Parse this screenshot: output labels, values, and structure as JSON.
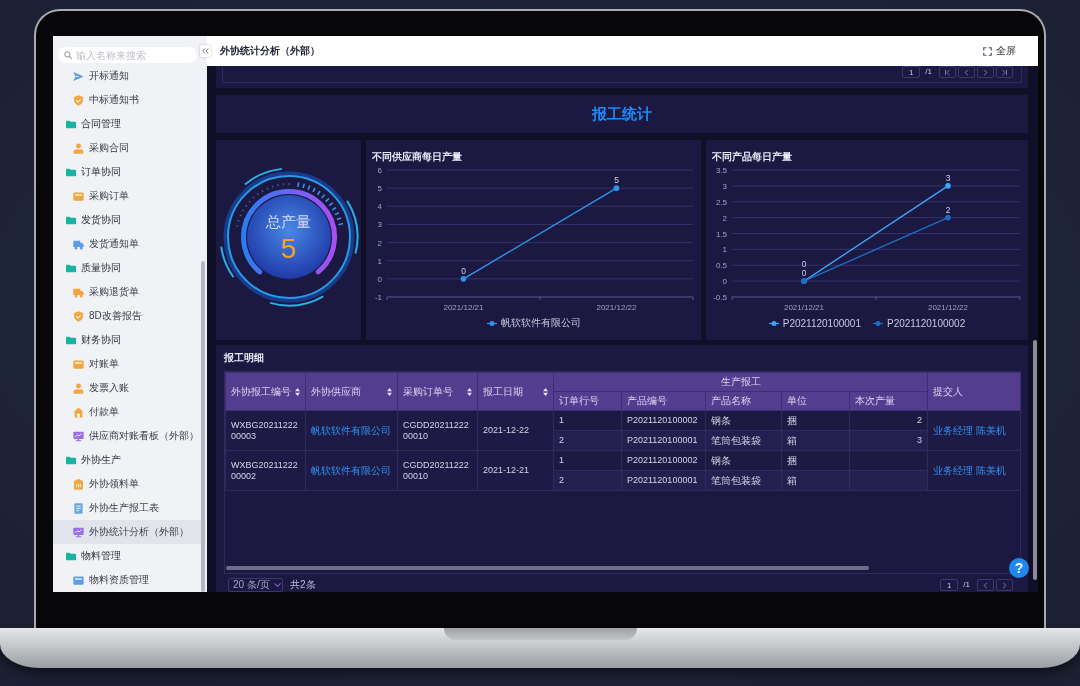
{
  "sidebar": {
    "search": {
      "placeholder": "输入名称来搜索"
    },
    "items": [
      {
        "children": [
          {
            "label": "开标通知",
            "kind": "send",
            "color": "#5b9de6",
            "selected": false
          },
          {
            "label": "中标通知书",
            "kind": "shield",
            "color": "#f2a640",
            "selected": false
          }
        ]
      },
      {
        "label": "合同管理",
        "children": [
          {
            "label": "采购合同",
            "kind": "person",
            "color": "#f2a640",
            "selected": false
          }
        ]
      },
      {
        "label": "订单协同",
        "children": [
          {
            "label": "采购订单",
            "kind": "card",
            "color": "#f2a640",
            "selected": false
          }
        ]
      },
      {
        "label": "发货协同",
        "children": [
          {
            "label": "发货通知单",
            "kind": "truck",
            "color": "#5b9de6",
            "selected": false
          }
        ]
      },
      {
        "label": "质量协同",
        "children": [
          {
            "label": "采购退货单",
            "kind": "truck",
            "color": "#f2a640",
            "selected": false
          },
          {
            "label": "8D改善报告",
            "kind": "shield",
            "color": "#f2a640",
            "selected": false
          }
        ]
      },
      {
        "label": "财务协同",
        "children": [
          {
            "label": "对账单",
            "kind": "card",
            "color": "#f2a640",
            "selected": false
          },
          {
            "label": "发票入账",
            "kind": "person",
            "color": "#f2a640",
            "selected": false
          },
          {
            "label": "付款单",
            "kind": "house",
            "color": "#f2a640",
            "selected": false
          },
          {
            "label": "供应商对账看板（外部）",
            "kind": "monitor",
            "color": "#9b6ee6",
            "selected": false
          }
        ]
      },
      {
        "label": "外协生产",
        "children": [
          {
            "label": "外协领料单",
            "kind": "clipboard",
            "color": "#f2a640",
            "selected": false
          },
          {
            "label": "外协生产报工表",
            "kind": "doc",
            "color": "#6aa6e0",
            "selected": false
          },
          {
            "label": "外协统计分析（外部）",
            "kind": "monitor",
            "color": "#9b6ee6",
            "selected": true
          }
        ]
      },
      {
        "label": "物料管理",
        "children": [
          {
            "label": "物料资质管理",
            "kind": "card",
            "color": "#5b9de6",
            "selected": false
          }
        ]
      }
    ]
  },
  "header": {
    "title": "外协统计分析（外部）",
    "fullscreen": "全屏"
  },
  "top_pager": {
    "page": "1",
    "total": "/1"
  },
  "report": {
    "title": "报工统计",
    "gauge": {
      "label": "总产量",
      "value": "5"
    },
    "charts": [
      {
        "chart_data": {
          "type": "line",
          "title": "不同供应商每日产量",
          "categories": [
            "2021/12/21",
            "2021/12/22"
          ],
          "series": [
            {
              "name": "帆软软件有限公司",
              "color": "#2f95e8",
              "values": [
                0,
                5
              ]
            }
          ],
          "ylim": [
            -1,
            6
          ],
          "yticks": [
            -1,
            0,
            1,
            2,
            3,
            4,
            5,
            6
          ],
          "grid": true,
          "data_labels": true,
          "legend": "bottom"
        }
      },
      {
        "chart_data": {
          "type": "line",
          "title": "不同产品每日产量",
          "categories": [
            "2021/12/21",
            "2021/12/22"
          ],
          "series": [
            {
              "name": "P2021120100001",
              "color": "#3ea4f4",
              "values": [
                0,
                3
              ]
            },
            {
              "name": "P2021120100002",
              "color": "#1f6cc4",
              "values": [
                0,
                2
              ]
            }
          ],
          "ylim": [
            -0.5,
            3.5
          ],
          "yticks": [
            -0.5,
            0,
            0.5,
            1,
            1.5,
            2,
            2.5,
            3,
            3.5
          ],
          "grid": true,
          "data_labels": true,
          "legend": "bottom"
        }
      }
    ]
  },
  "detail": {
    "title": "报工明细",
    "columns": [
      {
        "label": "外协报工编号",
        "sortable": true
      },
      {
        "label": "外协供应商",
        "sortable": true
      },
      {
        "label": "采购订单号",
        "sortable": true
      },
      {
        "label": "报工日期",
        "sortable": true
      },
      {
        "label": "生产报工",
        "children": [
          {
            "label": "订单行号",
            "sortable": false
          },
          {
            "label": "产品编号",
            "sortable": false
          },
          {
            "label": "产品名称",
            "sortable": false
          },
          {
            "label": "单位",
            "sortable": false
          },
          {
            "label": "本次产量",
            "sortable": false
          }
        ]
      },
      {
        "label": "提交人",
        "sortable": false
      }
    ],
    "rows": [
      {
        "report_no": "WXBG2021122200003",
        "supplier": "帆软软件有限公司",
        "order_no": "CGDD2021122200010",
        "date": "2021-12-22",
        "lines": [
          {
            "line_no": "1",
            "product_no": "P2021120100002",
            "product_name": "钢条",
            "unit": "捆",
            "quantity": "2"
          },
          {
            "line_no": "2",
            "product_no": "P2021120100001",
            "product_name": "笔筒包装袋",
            "unit": "箱",
            "quantity": "3"
          }
        ],
        "submitter": "业务经理 陈美机"
      },
      {
        "report_no": "WXBG2021122200002",
        "supplier": "帆软软件有限公司",
        "order_no": "CGDD2021122200010",
        "date": "2021-12-21",
        "lines": [
          {
            "line_no": "1",
            "product_no": "P2021120100002",
            "product_name": "钢条",
            "unit": "捆"
          },
          {
            "line_no": "2",
            "product_no": "P2021120100001",
            "product_name": "笔筒包装袋",
            "unit": "箱"
          }
        ],
        "submitter": "业务经理 陈美机"
      }
    ],
    "footer": {
      "page_size": "20 条/页",
      "total": "共2条",
      "page": "1",
      "pages": "/1"
    }
  },
  "help_button": {
    "label": "?"
  }
}
